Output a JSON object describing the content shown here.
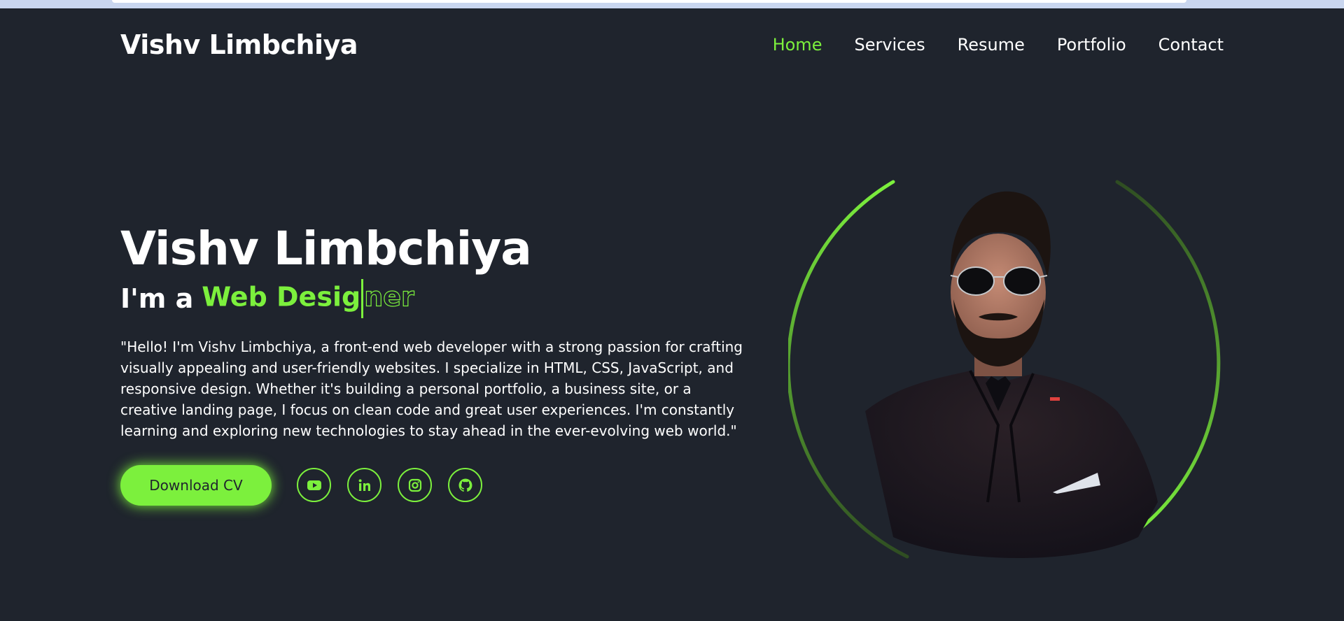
{
  "header": {
    "logo": "Vishv Limbchiya",
    "nav": [
      {
        "label": "Home",
        "active": true
      },
      {
        "label": "Services",
        "active": false
      },
      {
        "label": "Resume",
        "active": false
      },
      {
        "label": "Portfolio",
        "active": false
      },
      {
        "label": "Contact",
        "active": false
      }
    ]
  },
  "hero": {
    "name": "Vishv Limbchiya",
    "role_prefix": "I'm a",
    "role_typed": "Web Desig",
    "role_remaining": "ner",
    "description": "\"Hello! I'm Vishv Limbchiya, a front-end web developer with a strong passion for crafting visually appealing and user-friendly websites. I specialize in HTML, CSS, JavaScript, and responsive design. Whether it's building a personal portfolio, a business site, or a creative landing page, I focus on clean code and great user experiences. I'm constantly learning and exploring new technologies to stay ahead in the ever-evolving web world.\"",
    "download_label": "Download CV",
    "socials": [
      {
        "name": "youtube-icon"
      },
      {
        "name": "linkedin-icon"
      },
      {
        "name": "instagram-icon"
      },
      {
        "name": "github-icon"
      }
    ]
  },
  "colors": {
    "background": "#1f242d",
    "accent": "#7cf03d",
    "text": "#ffffff"
  }
}
